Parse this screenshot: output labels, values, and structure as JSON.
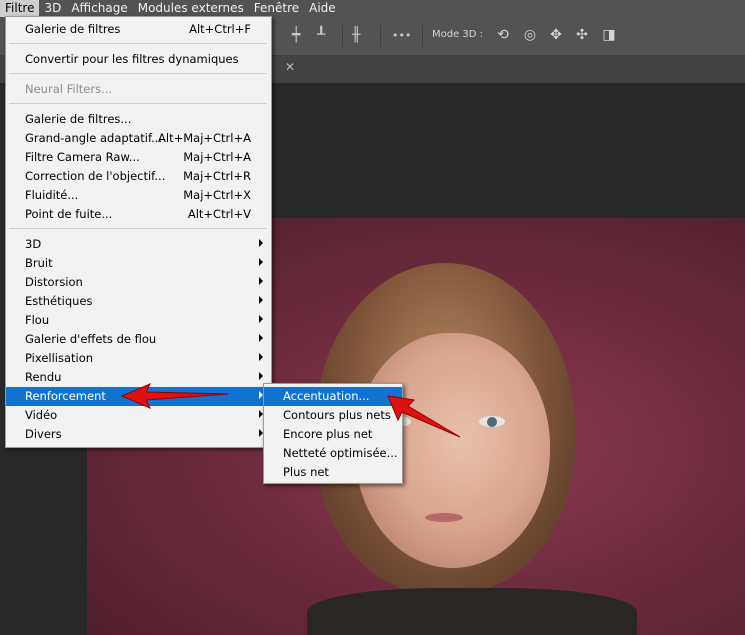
{
  "menubar": {
    "items": [
      "Filtre",
      "3D",
      "Affichage",
      "Modules externes",
      "Fenêtre",
      "Aide"
    ]
  },
  "options": {
    "mode3d_label": "Mode 3D :",
    "more_glyph": "•••"
  },
  "filter_menu": {
    "last_filter": {
      "label": "Galerie de filtres",
      "shortcut": "Alt+Ctrl+F"
    },
    "convert_smart": "Convertir pour les filtres dynamiques",
    "neural": "Neural Filters...",
    "items": [
      {
        "label": "Galerie de filtres...",
        "shortcut": ""
      },
      {
        "label": "Grand-angle adaptatif...",
        "shortcut": "Alt+Maj+Ctrl+A"
      },
      {
        "label": "Filtre Camera Raw...",
        "shortcut": "Maj+Ctrl+A"
      },
      {
        "label": "Correction de l'objectif...",
        "shortcut": "Maj+Ctrl+R"
      },
      {
        "label": "Fluidité...",
        "shortcut": "Maj+Ctrl+X"
      },
      {
        "label": "Point de fuite...",
        "shortcut": "Alt+Ctrl+V"
      }
    ],
    "submenus": [
      "3D",
      "Bruit",
      "Distorsion",
      "Esthétiques",
      "Flou",
      "Galerie d'effets de flou",
      "Pixellisation",
      "Rendu",
      "Renforcement",
      "Vidéo",
      "Divers"
    ],
    "highlighted": "Renforcement"
  },
  "sharpen_submenu": {
    "items": [
      "Accentuation...",
      "Contours plus nets",
      "Encore plus net",
      "Netteté optimisée...",
      "Plus net"
    ],
    "highlighted": "Accentuation..."
  },
  "colors": {
    "menubar": "#535353",
    "menu_bg": "#f2f2f2",
    "highlight": "#0f73d2",
    "annotation_arrow": "#e01010",
    "photo_backdrop": "#7a2e44"
  }
}
